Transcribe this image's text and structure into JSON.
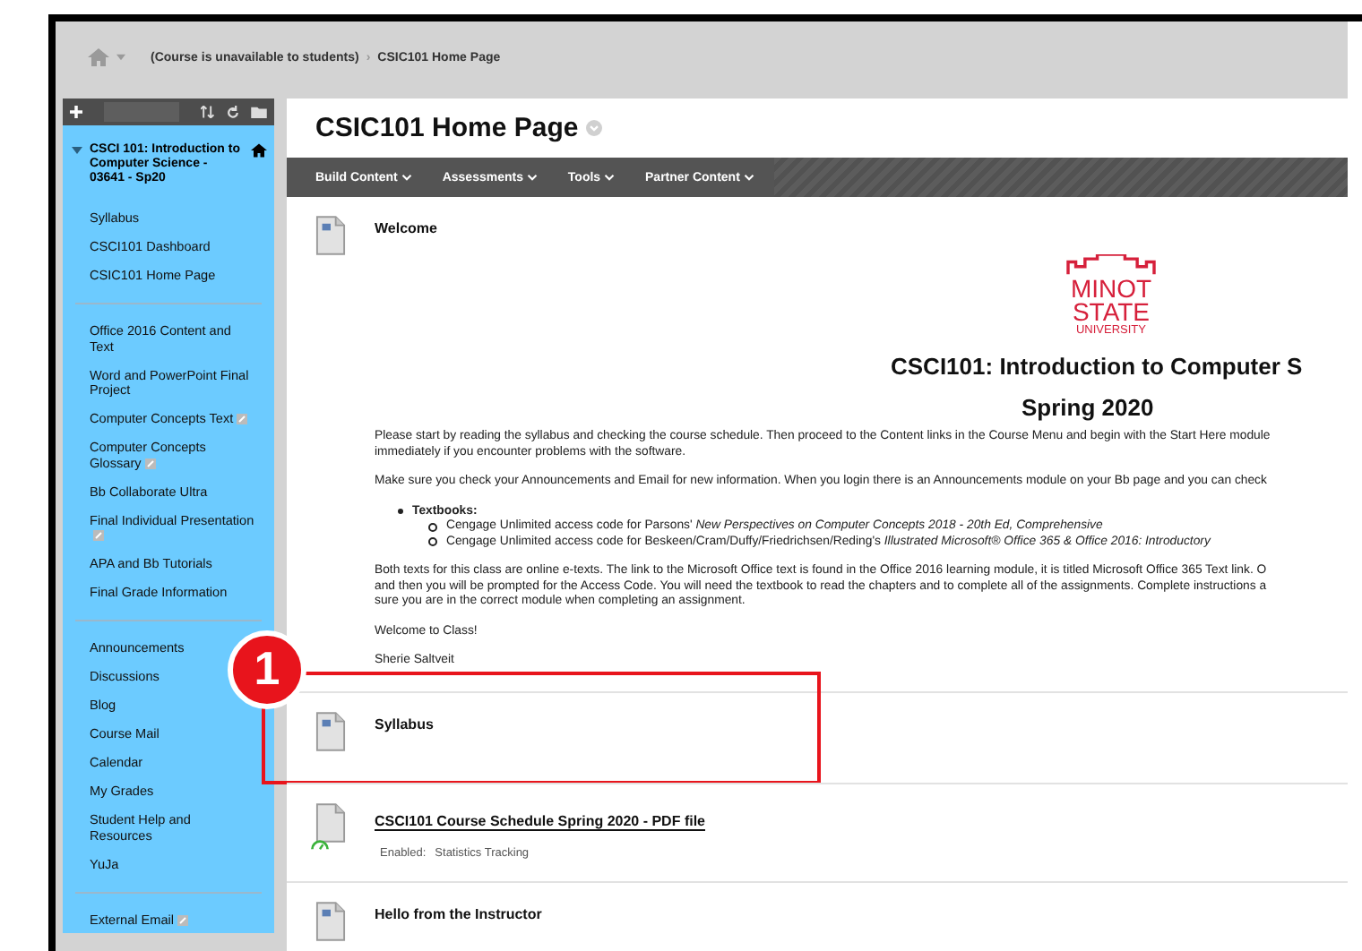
{
  "breadcrumb": {
    "separator": "›",
    "items": [
      "(Course is unavailable to students)",
      "CSIC101 Home Page"
    ]
  },
  "sidebar": {
    "course_title": "CSCI 101: Introduction to Computer Science - 03641 - Sp20",
    "expanded": true,
    "groups": [
      [
        {
          "label": "Syllabus",
          "external": false
        },
        {
          "label": "CSCI101 Dashboard",
          "external": false
        },
        {
          "label": "CSIC101 Home Page",
          "external": false
        }
      ],
      [
        {
          "label": "Office 2016 Content and Text",
          "external": false
        },
        {
          "label": "Word and PowerPoint Final Project",
          "external": false
        },
        {
          "label": "Computer Concepts Text",
          "external": true
        },
        {
          "label": "Computer Concepts Glossary",
          "external": true
        },
        {
          "label": "Bb Collaborate Ultra",
          "external": false
        },
        {
          "label": "Final Individual Presentation",
          "external": true
        },
        {
          "label": "APA and Bb Tutorials",
          "external": false
        },
        {
          "label": "Final Grade Information",
          "external": false
        }
      ],
      [
        {
          "label": "Announcements",
          "external": false
        },
        {
          "label": "Discussions",
          "external": false
        },
        {
          "label": "Blog",
          "external": false
        },
        {
          "label": "Course Mail",
          "external": false
        },
        {
          "label": "Calendar",
          "external": false
        },
        {
          "label": "My Grades",
          "external": false
        },
        {
          "label": "Student Help and Resources",
          "external": false
        },
        {
          "label": "YuJa",
          "external": false
        }
      ],
      [
        {
          "label": "External Email",
          "external": true
        }
      ]
    ]
  },
  "page_title": "CSIC101 Home Page",
  "toolbar": [
    "Build Content",
    "Assessments",
    "Tools",
    "Partner Content"
  ],
  "items": [
    {
      "kind": "document",
      "title": "Welcome",
      "link": false,
      "tracking": false,
      "highlighted": false,
      "body": [
        {
          "kind": "logo",
          "lines": [
            "MINOT",
            "STATE",
            "UNIVERSITY"
          ]
        },
        {
          "kind": "heading",
          "lines": [
            "CSCI101: Introduction to Computer S"
          ]
        },
        {
          "kind": "subheading",
          "lines": [
            "Spring 2020"
          ]
        },
        {
          "kind": "paragraph",
          "lines": [
            "Please start by reading the syllabus and checking the course schedule. Then proceed to the Content links in the Course Menu and begin with the Start Here module",
            "immediately if you encounter problems with the software."
          ]
        },
        {
          "kind": "paragraph",
          "lines": [
            "Make sure you check your Announcements and Email for new information. When you login there is an Announcements module on your Bb page and you can check"
          ]
        },
        {
          "kind": "list",
          "title": "Textbooks:",
          "lines": [
            "Cengage Unlimited access code for Parsons' *New Perspectives on Computer Concepts 2018 - 20th Ed, Comprehensive*",
            "Cengage Unlimited access code for Beskeen/Cram/Duffy/Friedrichsen/Reding's *Illustrated Microsoft® Office 365 & Office 2016: Introductory*"
          ]
        },
        {
          "kind": "paragraph",
          "lines": [
            "Both texts for this class are online e-texts. The link to the Microsoft Office text is found in the Office 2016 learning module, it is titled Microsoft Office 365 Text link. O",
            "and then you will be prompted for the Access Code. You will need the textbook to read the chapters and to complete all of the assignments. Complete instructions a",
            "sure you are in the correct module when completing an assignment."
          ]
        },
        {
          "kind": "paragraph",
          "lines": [
            "Welcome to Class!"
          ]
        },
        {
          "kind": "paragraph",
          "lines": [
            "Sherie Saltveit"
          ]
        }
      ]
    },
    {
      "kind": "document",
      "title": "Syllabus",
      "link": false,
      "tracking": false,
      "highlighted": true,
      "callout": "1"
    },
    {
      "kind": "file",
      "title": "CSCI101 Course Schedule Spring 2020 - PDF file",
      "link": true,
      "tracking": true,
      "highlighted": false,
      "details": [
        "Enabled:",
        "Statistics Tracking"
      ]
    },
    {
      "kind": "document",
      "title": "Hello from the Instructor",
      "link": false,
      "tracking": false,
      "highlighted": false
    }
  ]
}
